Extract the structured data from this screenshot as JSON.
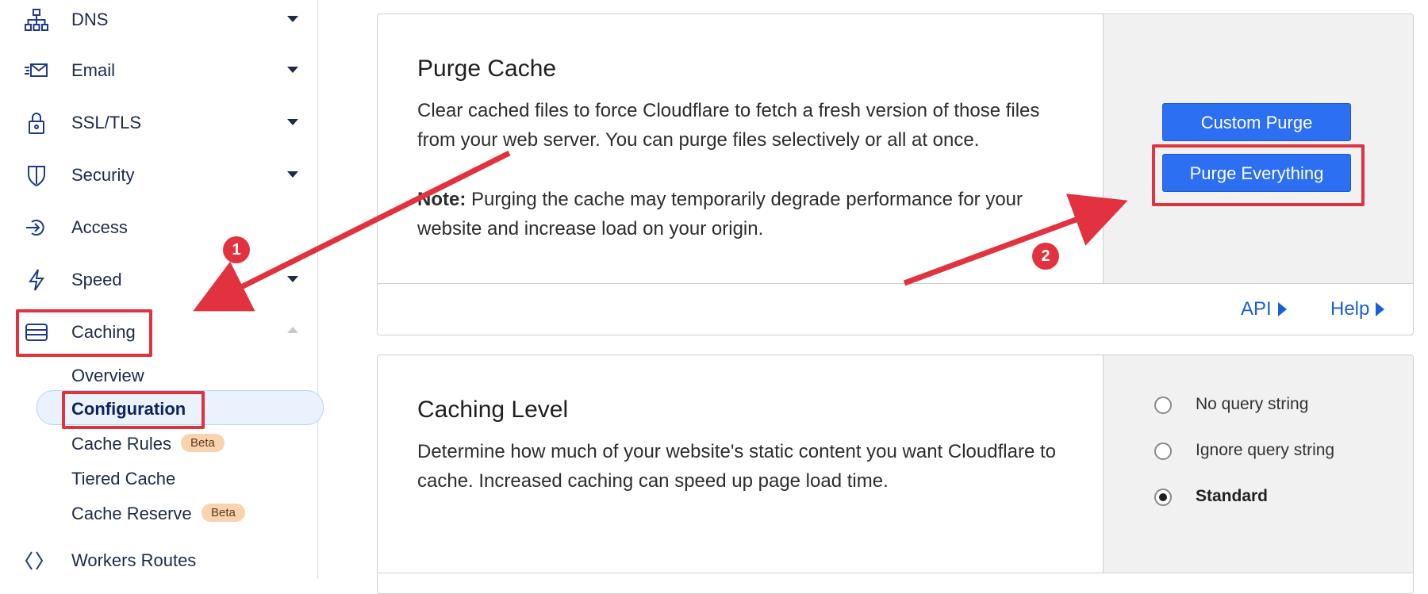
{
  "sidebar": {
    "items": [
      {
        "label": "DNS",
        "icon": "sitemap-icon"
      },
      {
        "label": "Email",
        "icon": "email-icon"
      },
      {
        "label": "SSL/TLS",
        "icon": "lock-icon"
      },
      {
        "label": "Security",
        "icon": "shield-icon"
      },
      {
        "label": "Access",
        "icon": "access-icon"
      },
      {
        "label": "Speed",
        "icon": "lightning-icon"
      },
      {
        "label": "Caching",
        "icon": "server-stack-icon"
      }
    ],
    "caching_subitems": [
      {
        "label": "Overview"
      },
      {
        "label": "Configuration"
      },
      {
        "label": "Cache Rules",
        "badge": "Beta"
      },
      {
        "label": "Tiered Cache"
      },
      {
        "label": "Cache Reserve",
        "badge": "Beta"
      }
    ],
    "workers_routes": {
      "label": "Workers Routes",
      "icon": "workers-icon"
    }
  },
  "purge_cache": {
    "title": "Purge Cache",
    "description": "Clear cached files to force Cloudflare to fetch a fresh version of those files from your web server. You can purge files selectively or all at once.",
    "note_label": "Note:",
    "note_text": " Purging the cache may temporarily degrade performance for your website and increase load on your origin.",
    "custom_purge_label": "Custom Purge",
    "purge_everything_label": "Purge Everything",
    "api_link": "API",
    "help_link": "Help"
  },
  "caching_level": {
    "title": "Caching Level",
    "description": "Determine how much of your website's static content you want Cloudflare to cache. Increased caching can speed up page load time.",
    "options": [
      {
        "label": "No query string",
        "checked": false
      },
      {
        "label": "Ignore query string",
        "checked": false
      },
      {
        "label": "Standard",
        "checked": true
      }
    ]
  },
  "annotations": {
    "step1": "1",
    "step2": "2",
    "highlight_color": "#e2323f"
  },
  "colors": {
    "primary_button": "#2c6ff3",
    "link": "#1b5fd6",
    "beta_badge": "#f9d3ad"
  }
}
